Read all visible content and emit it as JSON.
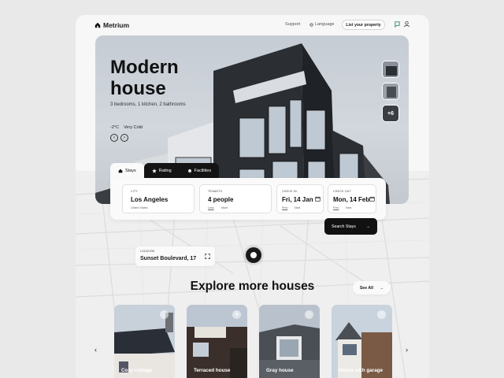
{
  "brand": {
    "name": "Metrium"
  },
  "nav": {
    "support": "Support",
    "language": "Language",
    "list_property": "List your property"
  },
  "hero": {
    "title_line1": "Modern",
    "title_line2": "house",
    "subtitle": "3 bedrooms, 1 kitchen, 2 bathrooms",
    "temperature": "-2°C",
    "weather": "Very Cold",
    "thumbnail_more": "+6"
  },
  "tabs": [
    {
      "label": "Stays",
      "icon": "home-icon"
    },
    {
      "label": "Rating",
      "icon": "star-icon"
    },
    {
      "label": "Facilities",
      "icon": "bell-icon"
    }
  ],
  "search": {
    "city": {
      "label": "CITY",
      "value": "Los Angeles",
      "sub": "United States"
    },
    "tenants": {
      "label": "TENANTS",
      "value": "4 people",
      "less": "Less",
      "more": "More"
    },
    "check_in": {
      "label": "CHECK IN",
      "value": "Fri, 14 Jan",
      "prev": "Prev",
      "next": "Next"
    },
    "check_out": {
      "label": "CHECK OUT",
      "value": "Mon, 14 Feb",
      "prev": "Prev",
      "next": "Next"
    },
    "button": "Search Stays"
  },
  "map": {
    "location_label": "LOCATION",
    "location_value": "Sunset Boulevard, 17"
  },
  "explore": {
    "title": "Explore more houses",
    "see_all": "See All"
  },
  "houses": [
    {
      "name": "Cozy cottage"
    },
    {
      "name": "Terraced house"
    },
    {
      "name": "Gray house"
    },
    {
      "name": "House with garage"
    }
  ],
  "colors": {
    "accent": "#111111",
    "background": "#e9e9ea",
    "card": "#f7f7f7"
  }
}
